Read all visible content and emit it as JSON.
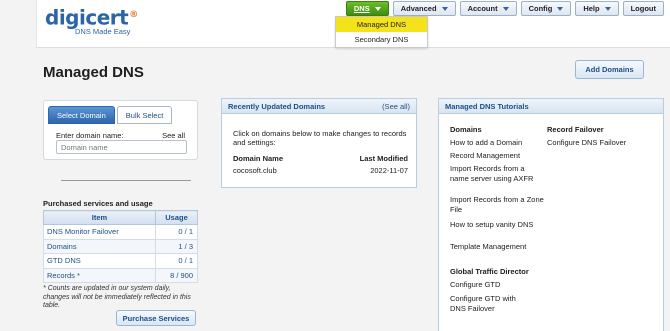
{
  "header": {
    "logo_text": "digicert",
    "logo_sub": "DNS Made Easy",
    "nav": [
      {
        "label": "DNS",
        "active": true
      },
      {
        "label": "Advanced",
        "active": false
      },
      {
        "label": "Account",
        "active": false
      },
      {
        "label": "Config",
        "active": false
      },
      {
        "label": "Help",
        "active": false
      }
    ],
    "logout": "Logout"
  },
  "dns_menu": {
    "items": [
      "Managed DNS",
      "Secondary DNS"
    ],
    "selected": "Managed DNS"
  },
  "page": {
    "title": "Managed DNS",
    "add_button": "Add Domains"
  },
  "select_domain": {
    "tabs": [
      "Select Domain",
      "Bulk Select"
    ],
    "enter_label": "Enter domain name:",
    "see_all": "See all",
    "input_placeholder": "Domain name"
  },
  "purchased": {
    "title": "Purchased services and usage",
    "columns": [
      "Item",
      "Usage"
    ],
    "rows": [
      {
        "item": "DNS Monitor Failover",
        "usage": "0 / 1"
      },
      {
        "item": "Domains",
        "usage": "1 / 3"
      },
      {
        "item": "GTD DNS",
        "usage": "0 / 1"
      },
      {
        "item": "Records *",
        "usage": "8 / 900"
      }
    ],
    "note": "* Counts are updated in our system daily, changes will not be immediately reflected in this table.",
    "purchase_button": "Purchase Services"
  },
  "recent": {
    "title": "Recently Updated Domains",
    "see_all": "(See all)",
    "description": "Click on domains below to make changes to records and settings:",
    "col_name": "Domain Name",
    "col_modified": "Last Modified",
    "rows": [
      {
        "name": "cocosoft.club",
        "modified": "2022-11-07"
      }
    ]
  },
  "tutorials": {
    "title": "Managed DNS Tutorials",
    "domains_head": "Domains",
    "domain_links": [
      "How to add a Domain",
      "Record Management",
      "Import Records from a name server using AXFR",
      "Import Records from a Zone File",
      "How to setup vanity DNS",
      "Template Management"
    ],
    "failover_head": "Record Failover",
    "failover_links": [
      "Configure DNS Failover"
    ],
    "gtd_head": "Global Traffic Director",
    "gtd_links": [
      "Configure GTD",
      "Configure GTD with DNS Failover"
    ]
  },
  "colors": {
    "brand_blue": "#2b64a8",
    "active_green": "#4f9e1a",
    "menu_highlight": "#f4e21a",
    "link_blue": "#1e4f86"
  }
}
